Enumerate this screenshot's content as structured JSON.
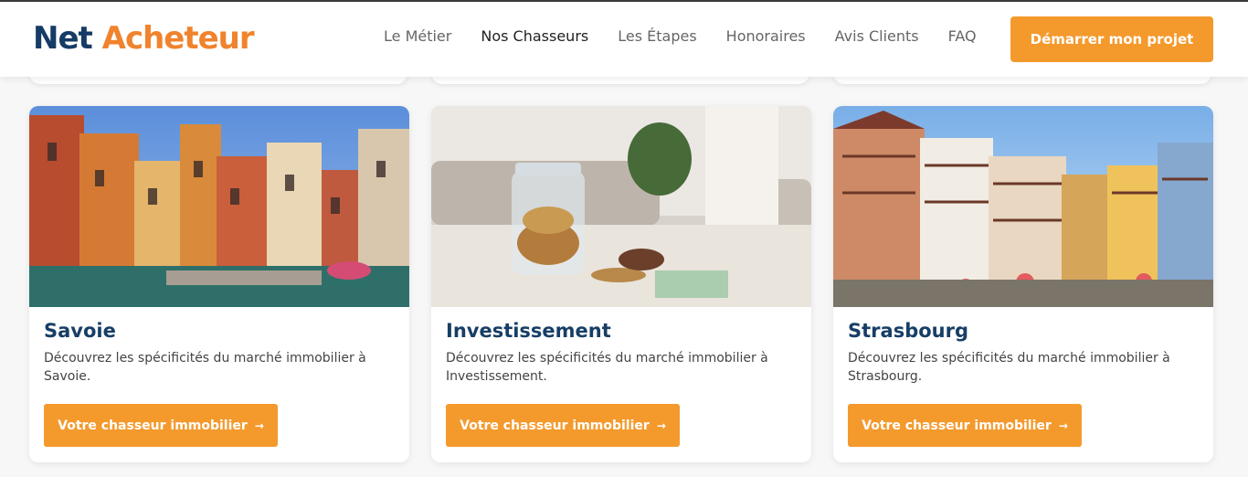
{
  "brand": {
    "part1": "Net",
    "part2": "Acheteur",
    "colors": {
      "blue": "#163b66",
      "orange": "#f0832d"
    }
  },
  "nav": {
    "items": [
      "Le Métier",
      "Nos Chasseurs",
      "Les Étapes",
      "Honoraires",
      "Avis Clients",
      "FAQ"
    ],
    "active": "Nos Chasseurs"
  },
  "cta": {
    "label": "Démarrer mon projet",
    "color": "#f49a2d"
  },
  "cards": [
    {
      "title": "Savoie",
      "description": "Découvrez les spécificités du marché immobilier à Savoie.",
      "button": "Votre chasseur immobilier",
      "arrow": "→"
    },
    {
      "title": "Investissement",
      "description": "Découvrez les spécificités du marché immobilier à Investissement.",
      "button": "Votre chasseur immobilier",
      "arrow": "→"
    },
    {
      "title": "Strasbourg",
      "description": "Découvrez les spécificités du marché immobilier à Strasbourg.",
      "button": "Votre chasseur immobilier",
      "arrow": "→"
    }
  ]
}
